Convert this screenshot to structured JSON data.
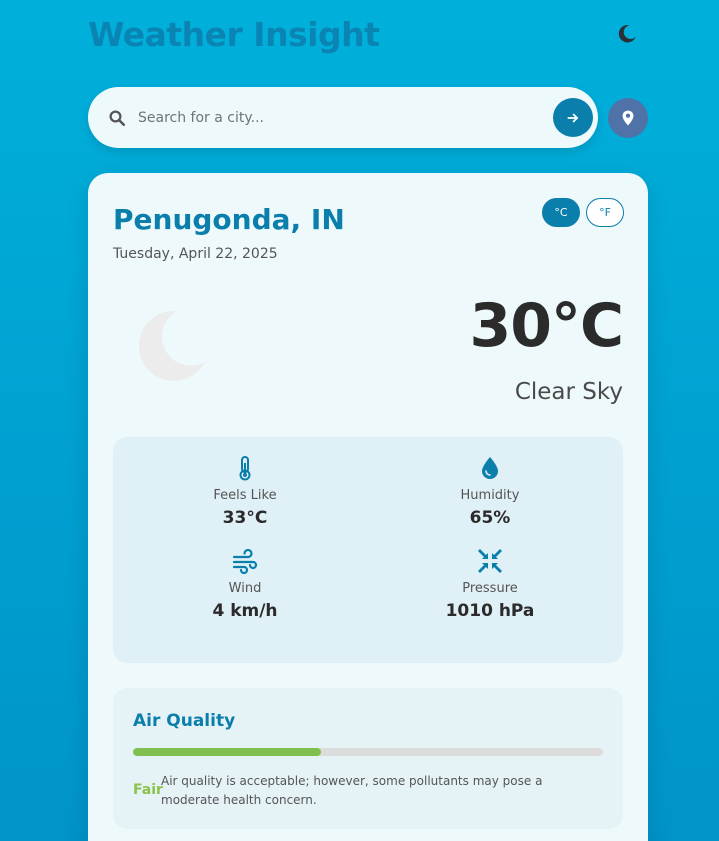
{
  "app": {
    "title": "Weather Insight"
  },
  "search": {
    "placeholder": "Search for a city..."
  },
  "location": {
    "city": "Penugonda, IN",
    "date": "Tuesday, April 22, 2025"
  },
  "units": {
    "celsius": "°C",
    "fahrenheit": "°F",
    "active": "celsius"
  },
  "current": {
    "temperature": "30°C",
    "condition": "Clear Sky",
    "icon": "moon-icon"
  },
  "details": [
    {
      "label": "Feels Like",
      "value": "33°C",
      "icon": "thermometer-icon"
    },
    {
      "label": "Humidity",
      "value": "65%",
      "icon": "droplet-icon"
    },
    {
      "label": "Wind",
      "value": "4 km/h",
      "icon": "wind-icon"
    },
    {
      "label": "Pressure",
      "value": "1010 hPa",
      "icon": "compress-icon"
    }
  ],
  "air_quality": {
    "title": "Air Quality",
    "level": "Fair",
    "description": "Air quality is acceptable; however, some pollutants may pose a moderate health concern.",
    "progress_fraction": 0.4,
    "color": "#7fbf4d"
  },
  "colors": {
    "background": "#00a8d6",
    "accent": "#0b7fab",
    "location_button": "#4f73a8",
    "card": "#eef9fc"
  }
}
